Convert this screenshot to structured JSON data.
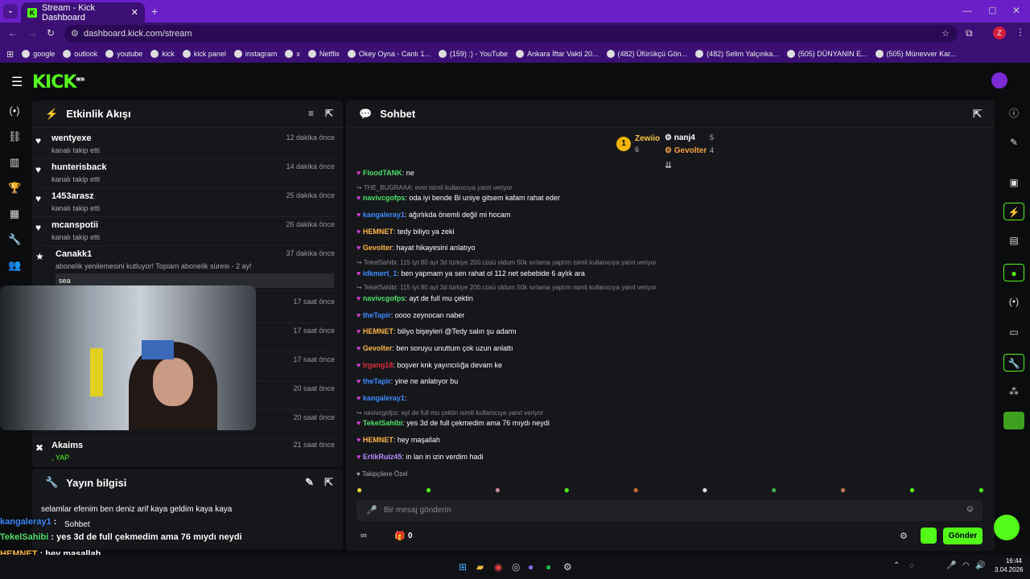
{
  "browser": {
    "tab_title": "Stream - Kick Dashboard",
    "url": "dashboard.kick.com/stream",
    "profile_initial": "Z",
    "bookmarks": [
      "google",
      "outlook",
      "youtube",
      "kick",
      "kick panel",
      "instagram",
      "x",
      "Netflix",
      "Okey Oyna - Canlı 1...",
      "(159) :) - YouTube",
      "Ankara İftar Vakti 20...",
      "(482) Üfürükçü Gön...",
      "(482) Selim Yalçınka...",
      "(505) DÜNYANIN E...",
      "(505) Münevver Kar..."
    ]
  },
  "kick": {
    "logo": "KICK",
    "beta": "BETA"
  },
  "activity": {
    "title": "Etkinlik Akışı",
    "events": [
      {
        "name": "wentyexe",
        "sub": "kanalı takip etti",
        "time": "12 dakika önce"
      },
      {
        "name": "hunterisback",
        "sub": "kanalı takip etti",
        "time": "14 dakika önce"
      },
      {
        "name": "1453arasz",
        "sub": "kanalı takip etti",
        "time": "25 dakika önce"
      },
      {
        "name": "mcanspotii",
        "sub": "kanalı takip etti",
        "time": "26 dakika önce"
      },
      {
        "name": "Canakk1",
        "sub": "abonelik yenilemesini kutluyor! Toplam abonelik süresi - 2 ay!",
        "time": "37 dakika önce",
        "note": "sea"
      },
      {
        "time": "17 saat önce"
      },
      {
        "time": "17 saat önce"
      },
      {
        "time": "17 saat önce"
      },
      {
        "time": "20 saat önce"
      },
      {
        "time": "20 saat önce"
      },
      {
        "name": "Akaims",
        "sub": ", YAP",
        "time": "21 saat önce"
      }
    ]
  },
  "stream_info": {
    "title": "Yayın bilgisi",
    "stream_title": "selamlar efenim ben deniz arif kaya geldim kaya kaya",
    "chat_label": "Sohbet"
  },
  "chat": {
    "title": "Sohbet",
    "leaders": [
      {
        "rank": "1",
        "name": "Zewiio",
        "count": "6"
      },
      {
        "name": "nanj4",
        "count": "5"
      },
      {
        "name": "Gevolter",
        "count": "4"
      }
    ],
    "messages": [
      {
        "user": "FloodTANK",
        "color": "#4fe06a",
        "text": "ne"
      },
      {
        "reply": "THE_BUGRAAA: evet isimli kullanıcıya yanıt veriyor"
      },
      {
        "user": "navivcgofps",
        "color": "#4fe06a",
        "text": "oda iyi bende Bi uniye gitsem kafam rahat eder"
      },
      {
        "user": "kangaleray1",
        "color": "#3d8bff",
        "text": "ağırlıkda önemli değil mi hocam"
      },
      {
        "user": "HEMNET",
        "color": "#ffb545",
        "text": "tedy biliyo ya zeki"
      },
      {
        "user": "Gevolter",
        "color": "#ffb545",
        "text": "hayat hikayesini anlatıyo"
      },
      {
        "reply": "TekelSahibi: 115 tyt 80 ayt 3d türkiye 200.cüsü oldum 50k sırlama yaptım isimli kullanıcıya yanıt veriyor"
      },
      {
        "user": "idkmert_1",
        "color": "#3d8bff",
        "text": "ben yapmam ya sen rahat ol 112 net sebebide 6 aylık ara"
      },
      {
        "reply": "TekelSahibi: 115 tyt 80 ayt 3d türkiye 200.cüsü oldum 50k sırlama yaptım isimli kullanıcıya yanıt veriyor"
      },
      {
        "user": "navivcgofps",
        "color": "#4fe06a",
        "text": "ayt de full mu çektin"
      },
      {
        "user": "theTapir",
        "color": "#3d8bff",
        "text": "oooo zeynocan naber"
      },
      {
        "user": "HEMNET",
        "color": "#ffb545",
        "text": "biliyo bişeyleri @Tedy salın şu adamı"
      },
      {
        "user": "Gevolter",
        "color": "#ffb545",
        "text": "ben soruyu unuttum çok uzun anlattı"
      },
      {
        "user": "Irgang18",
        "color": "#e0303a",
        "text": "boşver knk yayıncılığa devam ke"
      },
      {
        "user": "theTapir",
        "color": "#3d8bff",
        "text": "yine ne anlatıyor bu"
      },
      {
        "user": "kangaleray1",
        "color": "#3d8bff",
        "text": ""
      },
      {
        "reply": "navivcgofps: ayt de full mu çektin isimli kullanıcıya yanıt veriyor"
      },
      {
        "user": "TekelSahibi",
        "color": "#4fe06a",
        "text": "yes 3d de full çekmedim ama 76 mıydı neydi"
      },
      {
        "user": "HEMNET",
        "color": "#ffb545",
        "text": "hey maşallah"
      },
      {
        "user": "ErlikRulz45",
        "color": "#b58cff",
        "text": "in lan in izin verdim hadi"
      }
    ],
    "followers_only": "Takipçilere Özel",
    "placeholder": "Bir mesaj gönderin",
    "points": "0",
    "send": "Gönder"
  },
  "overlay": [
    {
      "user": "kangaleray1",
      "color": "#3d8bff",
      "text": ""
    },
    {
      "user": "TekelSahibi",
      "color": "#4fe06a",
      "text": "yes 3d de full çekmedim ama 76 mıydı neydi"
    },
    {
      "user": "HEMNET",
      "color": "#ffb545",
      "text": "hey maşallah"
    },
    {
      "user": "ErlikRulz45",
      "color": "#b58cff",
      "text": "in lan in izin verdim hadi"
    }
  ],
  "taskbar": {
    "time": "16:44",
    "date": "3.04.2026"
  }
}
